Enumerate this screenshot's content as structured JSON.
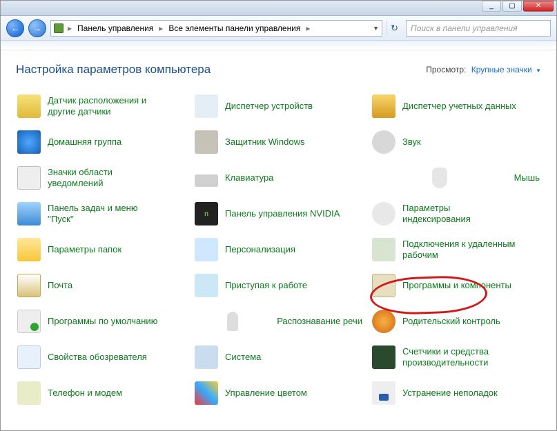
{
  "titlebar": {
    "min": "_",
    "max": "▢",
    "close": "✕"
  },
  "nav": {
    "back": "←",
    "forward": "→",
    "crumbs": [
      "Панель управления",
      "Все элементы панели управления"
    ],
    "refresh": "↻"
  },
  "search": {
    "placeholder": "Поиск в панели управления"
  },
  "header": {
    "title": "Настройка параметров компьютера",
    "view_label": "Просмотр:",
    "view_value": "Крупные значки"
  },
  "items": [
    {
      "label": "Датчик расположения и другие датчики",
      "icon": "i-sensor"
    },
    {
      "label": "Диспетчер устройств",
      "icon": "i-device"
    },
    {
      "label": "Диспетчер учетных данных",
      "icon": "i-cred"
    },
    {
      "label": "Домашняя группа",
      "icon": "i-home"
    },
    {
      "label": "Защитник Windows",
      "icon": "i-defend"
    },
    {
      "label": "Звук",
      "icon": "i-sound"
    },
    {
      "label": "Значки области уведомлений",
      "icon": "i-notif"
    },
    {
      "label": "Клавиатура",
      "icon": "i-kbd"
    },
    {
      "label": "Мышь",
      "icon": "i-mouse"
    },
    {
      "label": "Панель задач и меню ''Пуск''",
      "icon": "i-task"
    },
    {
      "label": "Панель управления NVIDIA",
      "icon": "i-nvidia"
    },
    {
      "label": "Параметры индексирования",
      "icon": "i-index"
    },
    {
      "label": "Параметры папок",
      "icon": "i-folder"
    },
    {
      "label": "Персонализация",
      "icon": "i-person"
    },
    {
      "label": "Подключения к удаленным рабочим",
      "icon": "i-remote"
    },
    {
      "label": "Почта",
      "icon": "i-mail"
    },
    {
      "label": "Приступая к работе",
      "icon": "i-start"
    },
    {
      "label": "Программы и компоненты",
      "icon": "i-prog"
    },
    {
      "label": "Программы по умолчанию",
      "icon": "i-default"
    },
    {
      "label": "Распознавание речи",
      "icon": "i-speech"
    },
    {
      "label": "Родительский контроль",
      "icon": "i-parent"
    },
    {
      "label": "Свойства обозревателя",
      "icon": "i-ieopts"
    },
    {
      "label": "Система",
      "icon": "i-system"
    },
    {
      "label": "Счетчики и средства производительности",
      "icon": "i-perf"
    },
    {
      "label": "Телефон и модем",
      "icon": "i-phone"
    },
    {
      "label": "Управление цветом",
      "icon": "i-color"
    },
    {
      "label": "Устранение неполадок",
      "icon": "i-trouble"
    }
  ]
}
